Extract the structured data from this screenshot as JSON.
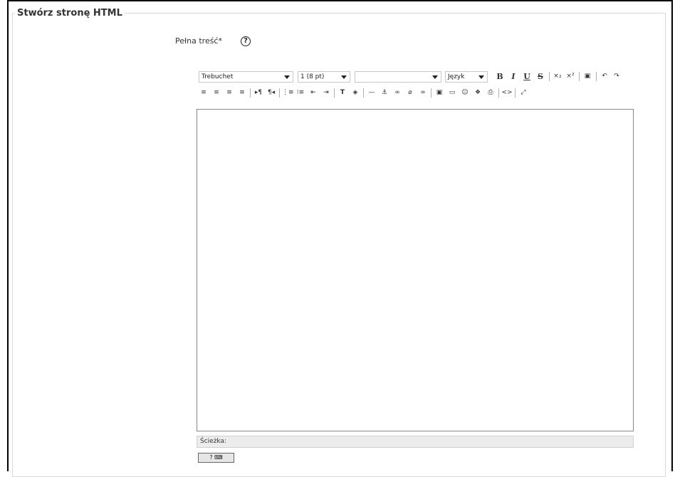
{
  "fieldset": {
    "legend": "Stwórz stronę HTML"
  },
  "field": {
    "label": "Pełna treść*",
    "help": "?"
  },
  "toolbar": {
    "font_family": "Trebuchet",
    "font_size": "1 (8 pt)",
    "heading": "",
    "language": "Język",
    "bold": "B",
    "italic": "I",
    "underline": "U",
    "strike": "S",
    "subscript": "×₂",
    "superscript": "×²",
    "paste_word": "▣",
    "undo": "↶",
    "redo": "↷",
    "align_left": "≡",
    "align_center": "≡",
    "align_right": "≡",
    "align_justify": "≡",
    "ltr": "▸¶",
    "rtl": "¶◂",
    "ordered_list": "⋮≡",
    "unordered_list": "⁝≡",
    "outdent": "⇤",
    "indent": "⇥",
    "text_color": "T",
    "bg_color": "◈",
    "horizontal_rule": "—",
    "anchor": "⚓",
    "link": "∞",
    "unlink": "⌀",
    "link_object": "∞",
    "image": "▣",
    "table": "▭",
    "smiley": "☺",
    "special_char": "❖",
    "search_replace": "⎙",
    "html_source": "<>",
    "fullscreen": "⤢"
  },
  "statusbar": {
    "path_label": "Ścieżka:"
  },
  "help_button": {
    "label": "?"
  }
}
